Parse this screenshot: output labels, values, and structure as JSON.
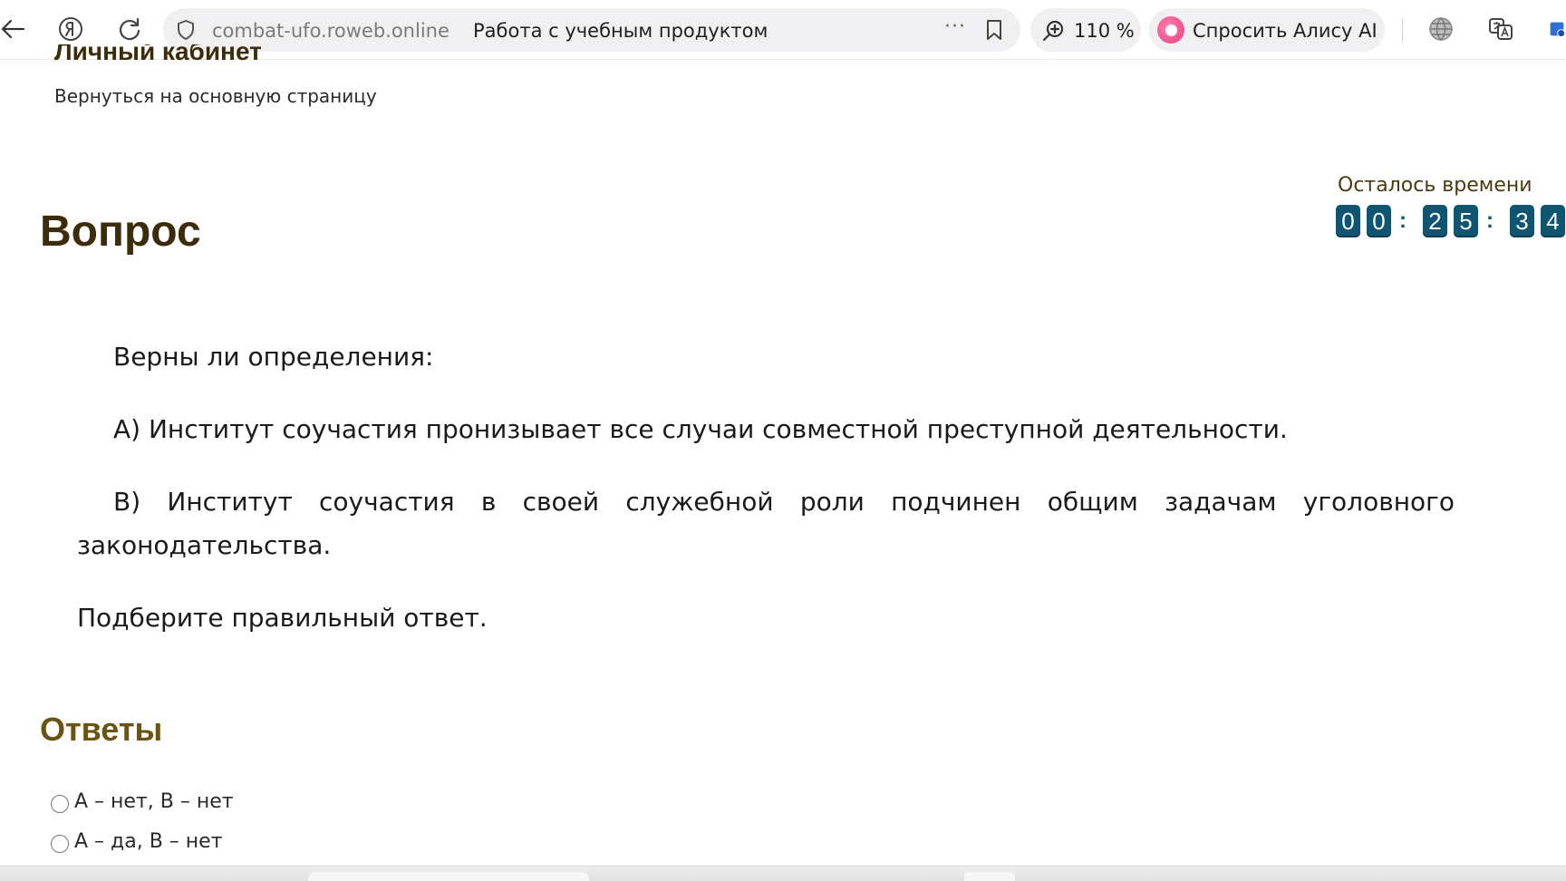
{
  "browser": {
    "domain": "combat-ufo.roweb.online",
    "page_title": "Работа с учебным продуктом",
    "more_label": "···",
    "zoom_level": "110 %",
    "alice_label": "Спросить Алису AI",
    "icons": [
      "back-arrow-icon",
      "yandex-icon",
      "reload-icon",
      "shield-icon",
      "bookmark-icon",
      "zoom-icon",
      "alice-icon",
      "globe-icon",
      "translate-icon",
      "extension-icon"
    ]
  },
  "header": {
    "cabinet_title": "Личный кабинет",
    "back_link": "Вернуться на основную страницу"
  },
  "question": {
    "title": "Вопрос",
    "paragraphs": [
      "Верны ли определения:",
      "А) Институт соучастия пронизывает все случаи совместной преступной деятельности.",
      "В) Институт соучастия в своей служебной роли подчинен общим задачам уголовного законодательства.",
      "Подберите правильный ответ."
    ]
  },
  "timer": {
    "label": "Осталось времени",
    "digits": [
      "0",
      "0",
      "2",
      "5",
      "3",
      "4"
    ],
    "separator": ":"
  },
  "answers": {
    "title": "Ответы",
    "options": [
      "А – нет, В – нет",
      "А – да, В – нет"
    ]
  },
  "colors": {
    "heading": "#3d2c0a",
    "answers_heading": "#6b5412",
    "timer_digit_bg": "#0f5470",
    "alice_accent": "#e8407f"
  }
}
